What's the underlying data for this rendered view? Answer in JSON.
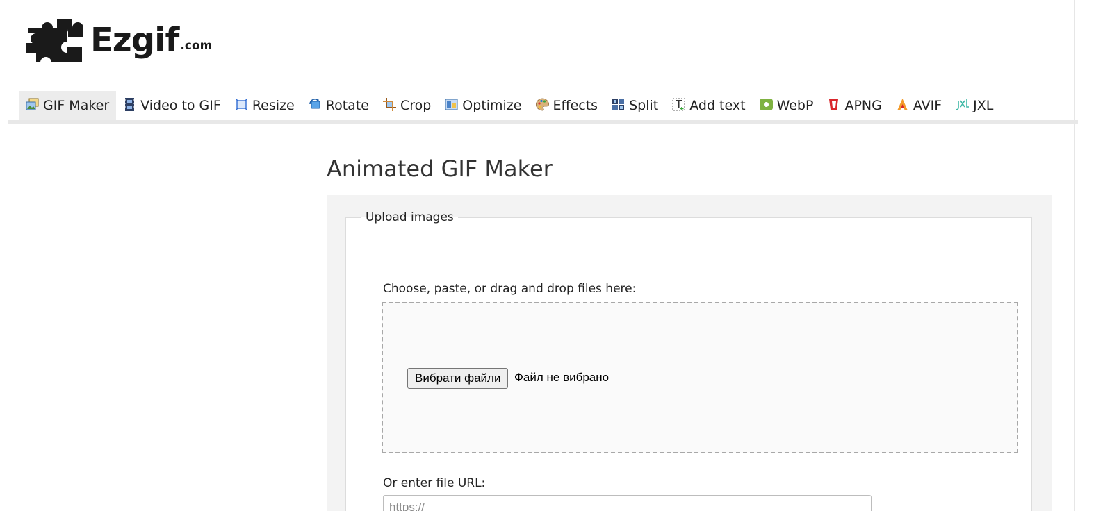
{
  "logo": {
    "word": "Ezgif",
    "suffix": ".com"
  },
  "nav": {
    "items": [
      {
        "label": "GIF Maker",
        "icon": "gif-maker-icon",
        "active": true
      },
      {
        "label": "Video to GIF",
        "icon": "film-icon"
      },
      {
        "label": "Resize",
        "icon": "resize-icon"
      },
      {
        "label": "Rotate",
        "icon": "rotate-icon"
      },
      {
        "label": "Crop",
        "icon": "crop-icon"
      },
      {
        "label": "Optimize",
        "icon": "optimize-icon"
      },
      {
        "label": "Effects",
        "icon": "palette-icon"
      },
      {
        "label": "Split",
        "icon": "split-icon"
      },
      {
        "label": "Add text",
        "icon": "add-text-icon"
      },
      {
        "label": "WebP",
        "icon": "webp-icon"
      },
      {
        "label": "APNG",
        "icon": "apng-icon"
      },
      {
        "label": "AVIF",
        "icon": "avif-icon"
      },
      {
        "label": "JXL",
        "icon": "jxl-icon"
      }
    ]
  },
  "main": {
    "title": "Animated GIF Maker",
    "upload": {
      "legend": "Upload images",
      "choose_label": "Choose, paste, or drag and drop files here:",
      "file_button": "Вибрати файли",
      "file_status": "Файл не вибрано",
      "url_label": "Or enter file URL:",
      "url_placeholder": "https://"
    }
  },
  "colors": {
    "nav_active_bg": "#ececec",
    "panel_bg": "#f3f3f3",
    "dropzone_border": "#a8a8a8"
  }
}
